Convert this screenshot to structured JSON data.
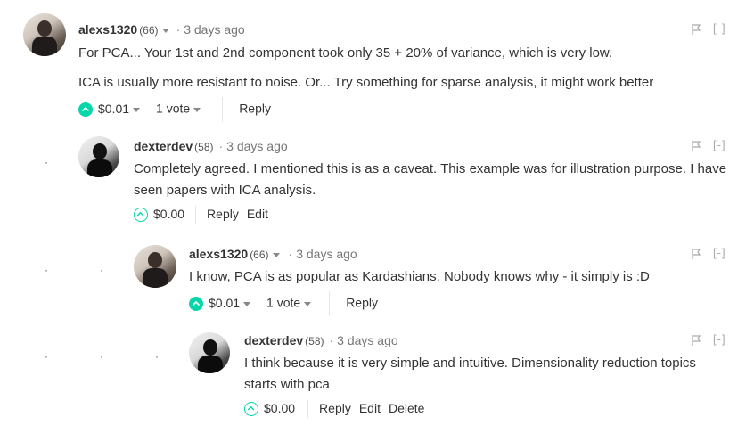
{
  "comments": [
    {
      "author": "alexs1320",
      "reputation": "(66)",
      "time": "3 days ago",
      "paragraphs": [
        "For PCA... Your 1st and 2nd component took only 35 + 20% of variance, which is very low.",
        "ICA is usually more resistant to noise. Or... Try something for sparse analysis, it might work better"
      ],
      "payout": "$0.01",
      "votes": "1 vote",
      "reply_label": "Reply",
      "collapse_label": "[-]"
    },
    {
      "author": "dexterdev",
      "reputation": "(58)",
      "time": "3 days ago",
      "paragraphs": [
        "Completely agreed. I mentioned this is as a caveat. This example was for illustration purpose. I have seen papers with ICA analysis."
      ],
      "payout": "$0.00",
      "reply_label": "Reply",
      "edit_label": "Edit",
      "collapse_label": "[-]"
    },
    {
      "author": "alexs1320",
      "reputation": "(66)",
      "time": "3 days ago",
      "paragraphs": [
        "I know, PCA is as popular as Kardashians. Nobody knows why - it simply is :D"
      ],
      "payout": "$0.01",
      "votes": "1 vote",
      "reply_label": "Reply",
      "collapse_label": "[-]"
    },
    {
      "author": "dexterdev",
      "reputation": "(58)",
      "time": "3 days ago",
      "paragraphs": [
        "I think because it is very simple and intuitive. Dimensionality reduction topics starts with pca"
      ],
      "payout": "$0.00",
      "reply_label": "Reply",
      "edit_label": "Edit",
      "delete_label": "Delete",
      "collapse_label": "[-]"
    }
  ],
  "colors": {
    "upvote": "#06d6a9",
    "text": "#333333",
    "muted": "#777777"
  },
  "icons": {
    "upvote": "chevron-up-icon",
    "flag": "flag-icon",
    "caret": "caret-down-icon"
  }
}
